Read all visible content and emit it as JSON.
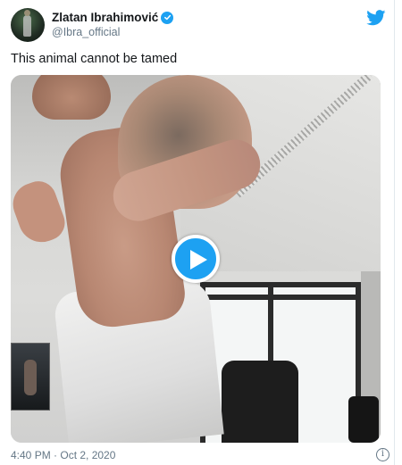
{
  "tweet": {
    "author": {
      "display_name": "Zlatan Ibrahimović",
      "handle": "@Ibra_official",
      "verified": true,
      "avatar_icon": "avatar-photo"
    },
    "text": "This animal cannot be tamed",
    "media": {
      "type": "video",
      "play_icon": "play-icon"
    },
    "timestamp": "4:40 PM · Oct 2, 2020",
    "info_icon": "info-icon"
  },
  "colors": {
    "accent": "#1da1f2",
    "text": "#14171a",
    "secondary_text": "#657786"
  }
}
